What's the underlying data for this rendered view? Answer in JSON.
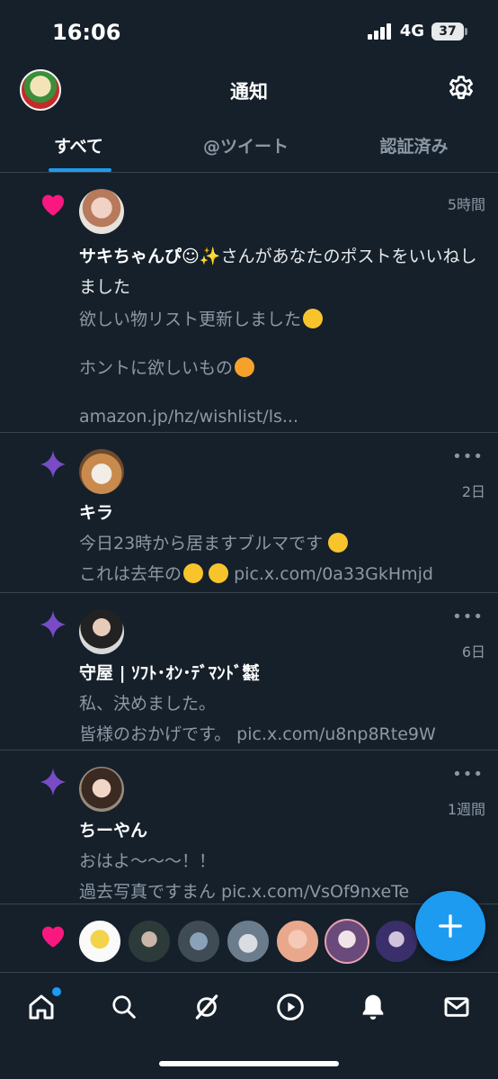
{
  "status_bar": {
    "time": "16:06",
    "network": "4G",
    "battery": "37"
  },
  "header": {
    "title": "通知"
  },
  "tabs": [
    {
      "label": "すべて",
      "active": true
    },
    {
      "label": "@ツイート",
      "active": false
    },
    {
      "label": "認証済み",
      "active": false
    }
  ],
  "notifications": [
    {
      "type": "like",
      "time": "5時間",
      "name": "サキちゃんぴ☺✨",
      "action": "さんがあなたのポストをいいねしました",
      "lines": [
        "欲しい物リスト更新しました",
        "ホントに欲しいもの",
        "amazon.jp/hz/wishlist/ls..."
      ]
    },
    {
      "type": "recommended",
      "time": "2日",
      "name": "キラ",
      "lines": [
        "今日23時から居ますブルマです",
        "これは去年の",
        "pic.x.com/0a33GkHmjd"
      ]
    },
    {
      "type": "recommended",
      "time": "6日",
      "name": "守屋 | ｿﾌﾄ･ｵﾝ･ﾃﾞﾏﾝﾄﾞ㍿",
      "lines": [
        "私、決めました。",
        "皆様のおかげです。 pic.x.com/u8np8Rte9W"
      ]
    },
    {
      "type": "recommended",
      "time": "1週間",
      "name": "ちーやん",
      "lines": [
        "おはよ〜〜〜！！",
        "過去写真ですまん pic.x.com/VsOf9nxeTe"
      ]
    }
  ],
  "colors": {
    "accent": "#1d9bf0",
    "like": "#f91880",
    "sparkle": "#794bc4",
    "background": "#15202b"
  },
  "icons": {
    "nav": [
      "home-icon",
      "search-icon",
      "grok-icon",
      "video-icon",
      "bell-icon",
      "mail-icon"
    ],
    "compose": "plus-icon"
  }
}
